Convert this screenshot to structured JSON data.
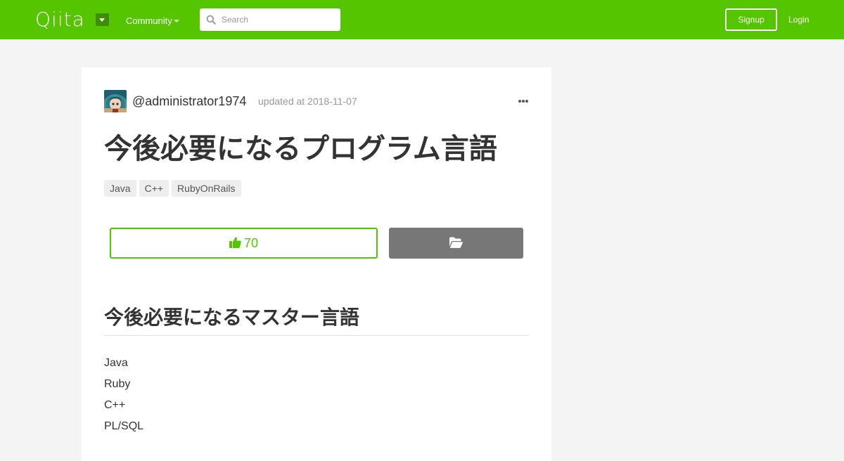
{
  "header": {
    "logo_text": "Qiita",
    "community_label": "Community",
    "search": {
      "placeholder": "Search",
      "value": ""
    },
    "signup_label": "Signup",
    "login_label": "Login"
  },
  "article": {
    "author": "@administrator1974",
    "updated": "updated at 2018-11-07",
    "title": "今後必要になるプログラム言語",
    "tags": [
      "Java",
      "C++",
      "RubyOnRails"
    ],
    "like_count": "70",
    "section_heading": "今後必要になるマスター言語",
    "languages": [
      "Java",
      "Ruby",
      "C++",
      "PL/SQL"
    ]
  },
  "colors": {
    "brand": "#55c500",
    "stock_button": "#777777",
    "background": "#f4f4f4"
  },
  "icons": {
    "search": "search-icon",
    "more": "more-icon",
    "like": "thumbs-up-icon",
    "stock": "folder-open-icon",
    "logo_menu": "chevron-down-icon"
  }
}
